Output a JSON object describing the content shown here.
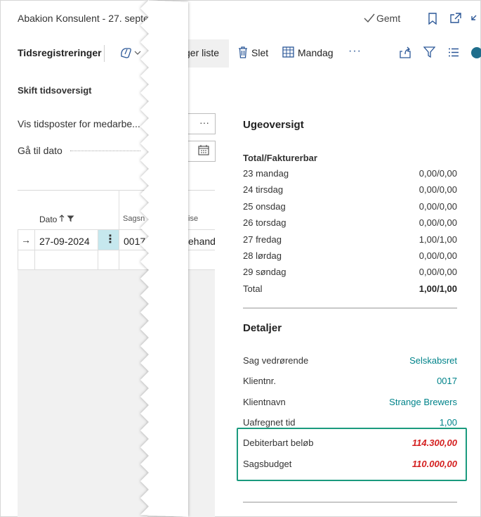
{
  "header": {
    "title": "Abakion Konsulent - 27. septe",
    "saved_label": "Gemt"
  },
  "toolbar": {
    "title": "Tidsregistreringer",
    "partial_label": "ger liste",
    "delete_label": "Slet",
    "calendar_label": "Mandag",
    "more_label": "···"
  },
  "left_panel": {
    "section_title": "Skift tidsoversigt",
    "field1_label": "Vis tidsposter for medarbe...",
    "field1_button": "···",
    "field2_label": "Gå til dato",
    "columns": {
      "dato": "Dato",
      "sagsnr": "Sagsn",
      "beskrivelse": "ise"
    },
    "row": {
      "arrow": "→",
      "date": "27-09-2024",
      "menu": "⋮",
      "sagsnr": "0017",
      "beskrivelse": "ehand"
    }
  },
  "ugeoversigt": {
    "title": "Ugeoversigt",
    "header_label": "Total/Fakturerbar",
    "rows": [
      {
        "label": "23 mandag",
        "value": "0,00/0,00"
      },
      {
        "label": "24 tirsdag",
        "value": "0,00/0,00"
      },
      {
        "label": "25 onsdag",
        "value": "0,00/0,00"
      },
      {
        "label": "26 torsdag",
        "value": "0,00/0,00"
      },
      {
        "label": "27 fredag",
        "value": "1,00/1,00"
      },
      {
        "label": "28 lørdag",
        "value": "0,00/0,00"
      },
      {
        "label": "29 søndag",
        "value": "0,00/0,00"
      }
    ],
    "total_label": "Total",
    "total_value": "1,00/1,00"
  },
  "detaljer": {
    "title": "Detaljer",
    "rows": [
      {
        "label": "Sag vedrørende",
        "value": "Selskabsret"
      },
      {
        "label": "Klientnr.",
        "value": "0017"
      },
      {
        "label": "Klientnavn",
        "value": "Strange Brewers"
      },
      {
        "label": "Uafregnet tid",
        "value": "1,00"
      }
    ],
    "highlight": [
      {
        "label": "Debiterbart beløb",
        "value": "114.300,00"
      },
      {
        "label": "Sagsbudget",
        "value": "110.000,00"
      }
    ]
  },
  "colors": {
    "accent_teal": "#00838a",
    "highlight_border": "#1a9a7e",
    "warning_red": "#d42020",
    "selected_cell": "#c6e8ee"
  }
}
